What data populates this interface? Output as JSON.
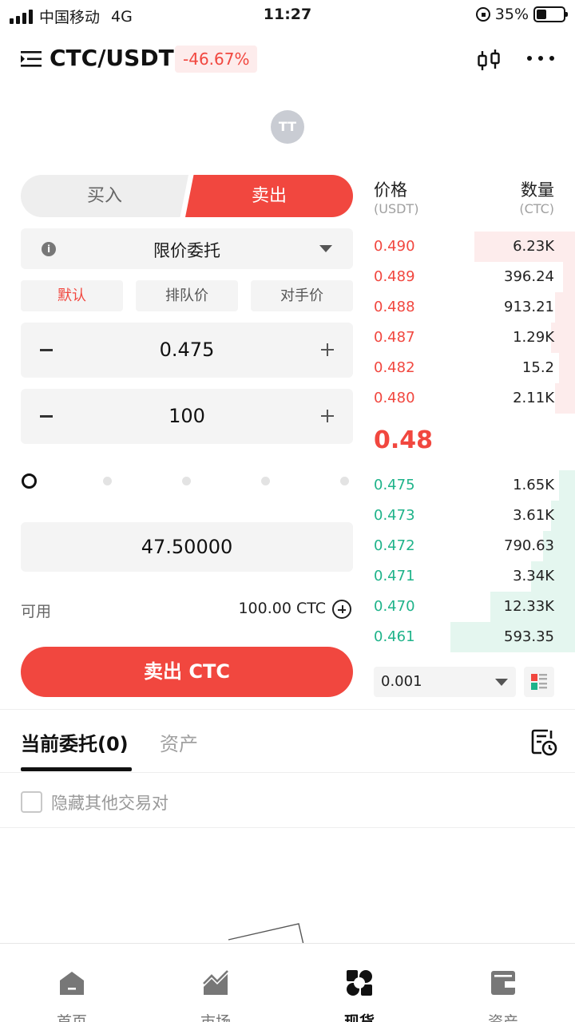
{
  "status_bar": {
    "carrier": "中国移动",
    "network": "4G",
    "time": "11:27",
    "battery": "35%"
  },
  "header": {
    "pair": "CTC/USDT",
    "change": "-46.67%"
  },
  "coin_logo_text": "TT",
  "trade_toggle": {
    "buy": "买入",
    "sell": "卖出"
  },
  "order_type": "限价委托",
  "price_tabs": [
    "默认",
    "排队价",
    "对手价"
  ],
  "price_input": {
    "value": "0.475"
  },
  "amount_input": {
    "value": "100"
  },
  "slider": {
    "percent": 0
  },
  "total": "47.50000",
  "available": {
    "label": "可用",
    "value": "100.00 CTC"
  },
  "submit_label": "卖出 CTC",
  "order_book": {
    "price_header": "价格",
    "price_unit": "(USDT)",
    "qty_header": "数量",
    "qty_unit": "(CTC)",
    "asks": [
      {
        "price": "0.490",
        "qty": "6.23K",
        "depth": 0.5
      },
      {
        "price": "0.489",
        "qty": "396.24",
        "depth": 0.06
      },
      {
        "price": "0.488",
        "qty": "913.21",
        "depth": 0.1
      },
      {
        "price": "0.487",
        "qty": "1.29K",
        "depth": 0.12
      },
      {
        "price": "0.482",
        "qty": "15.2",
        "depth": 0.08
      },
      {
        "price": "0.480",
        "qty": "2.11K",
        "depth": 0.1
      }
    ],
    "mid_price": "0.48",
    "bids": [
      {
        "price": "0.475",
        "qty": "1.65K",
        "depth": 0.08
      },
      {
        "price": "0.473",
        "qty": "3.61K",
        "depth": 0.12
      },
      {
        "price": "0.472",
        "qty": "790.63",
        "depth": 0.16
      },
      {
        "price": "0.471",
        "qty": "3.34K",
        "depth": 0.22
      },
      {
        "price": "0.470",
        "qty": "12.33K",
        "depth": 0.42
      },
      {
        "price": "0.461",
        "qty": "593.35",
        "depth": 0.62
      }
    ],
    "precision": "0.001"
  },
  "orders_tabs": {
    "current": "当前委托(0)",
    "assets": "资产"
  },
  "hide_other_pairs": "隐藏其他交易对",
  "bottom_nav": [
    {
      "label": "首页",
      "icon": "home-icon"
    },
    {
      "label": "市场",
      "icon": "market-chart-icon"
    },
    {
      "label": "现货",
      "icon": "spot-trade-icon"
    },
    {
      "label": "资产",
      "icon": "wallet-icon"
    }
  ],
  "colors": {
    "sell_red": "#f1473f",
    "buy_green": "#1fb38a",
    "ask_bg": "#fdecec",
    "bid_bg": "#e4f6ef"
  }
}
